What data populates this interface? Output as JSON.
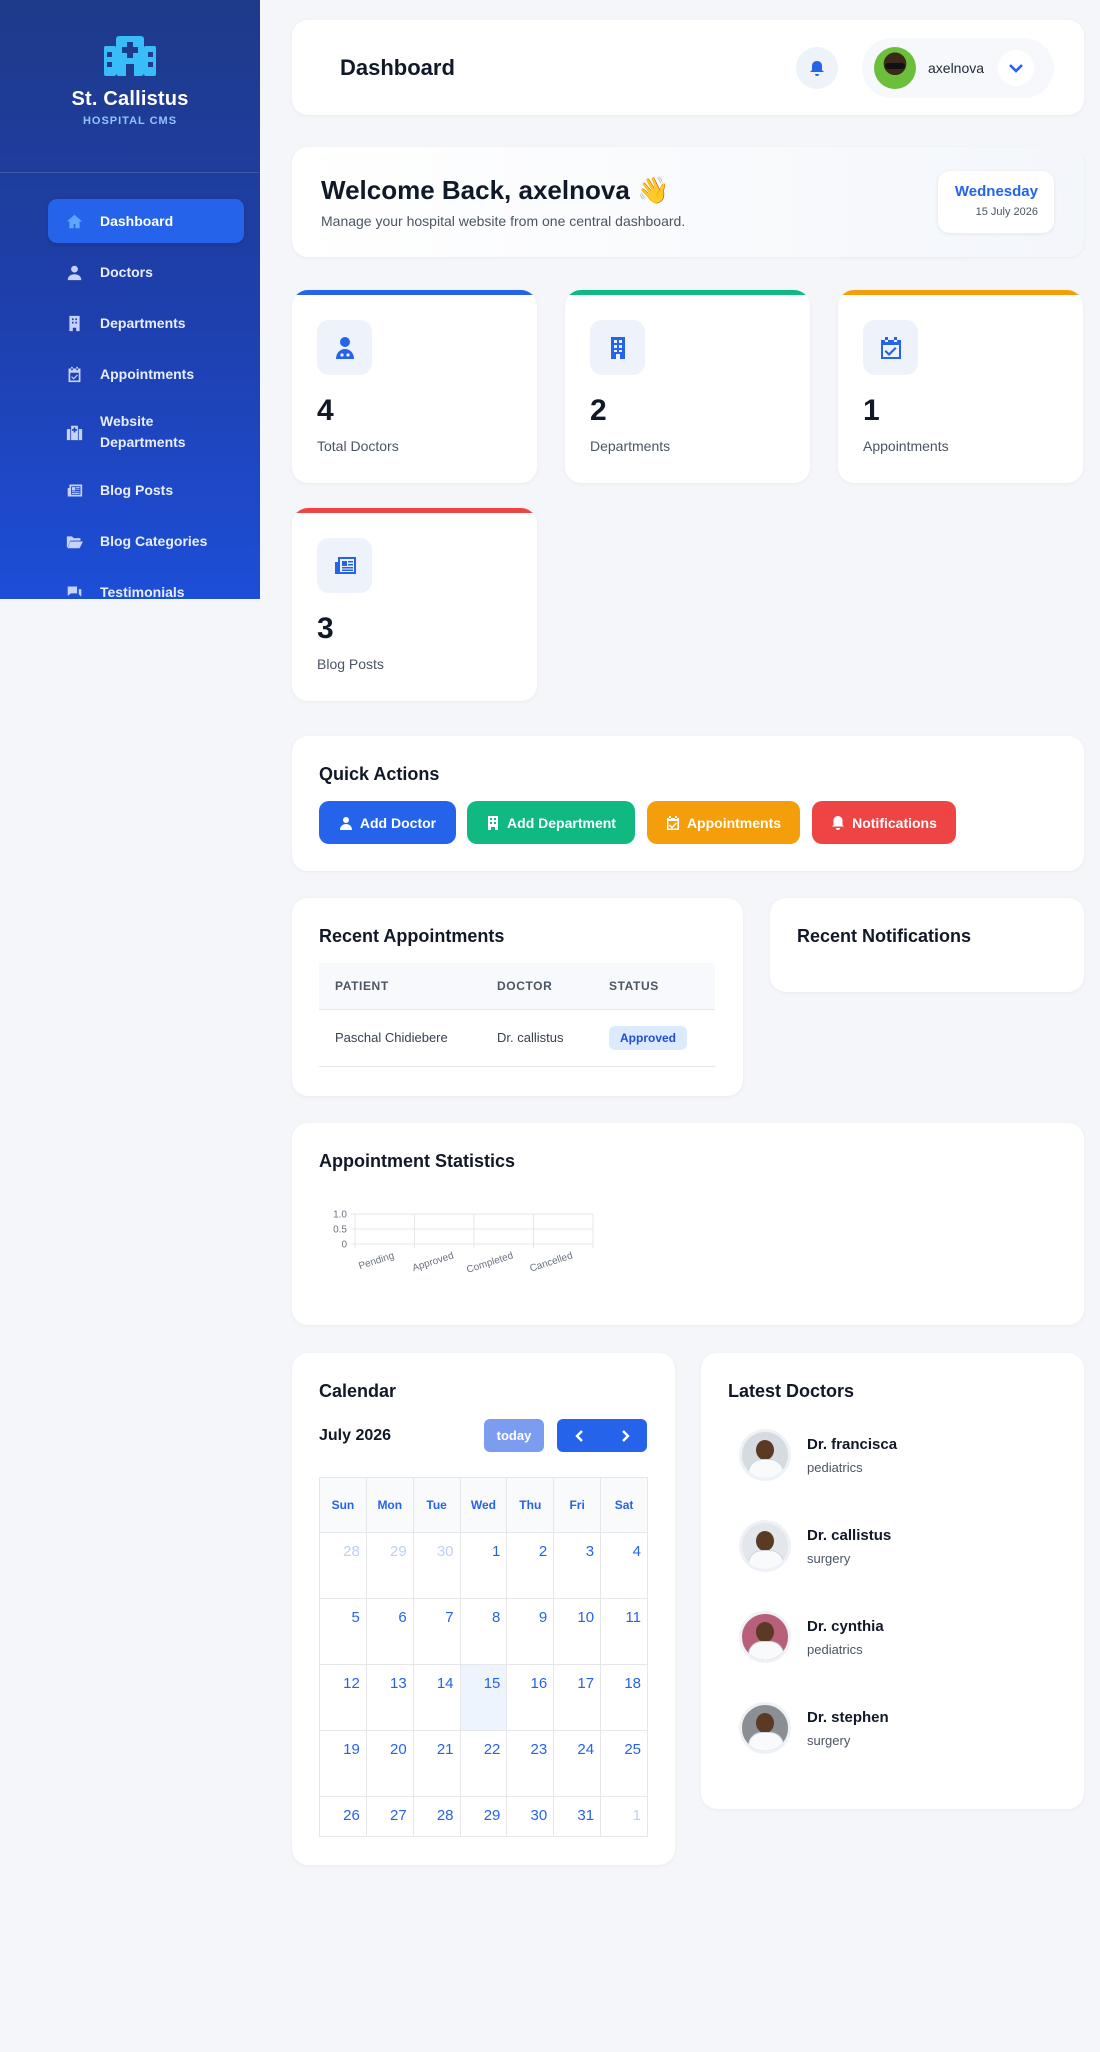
{
  "sidebar": {
    "brand_name": "St. Callistus",
    "brand_sub": "HOSPITAL CMS",
    "items": [
      {
        "label": "Dashboard",
        "icon": "home-icon"
      },
      {
        "label": "Doctors",
        "icon": "user-icon"
      },
      {
        "label": "Departments",
        "icon": "building-icon"
      },
      {
        "label": "Appointments",
        "icon": "calendar-check-icon"
      },
      {
        "label": "Website Departments",
        "icon": "hospital-icon"
      },
      {
        "label": "Blog Posts",
        "icon": "newspaper-icon"
      },
      {
        "label": "Blog Categories",
        "icon": "folder-open-icon"
      },
      {
        "label": "Testimonials",
        "icon": "comments-icon"
      }
    ]
  },
  "header": {
    "title": "Dashboard",
    "user_name": "axelnova"
  },
  "welcome": {
    "title": "Welcome Back, axelnova 👋",
    "subtitle": "Manage your hospital website from one central dashboard.",
    "day": "Wednesday",
    "date": "15 July 2026"
  },
  "stats": [
    {
      "value": "4",
      "label": "Total Doctors",
      "color": "#2563eb"
    },
    {
      "value": "2",
      "label": "Departments",
      "color": "#10b981"
    },
    {
      "value": "1",
      "label": "Appointments",
      "color": "#f59e0b"
    },
    {
      "value": "3",
      "label": "Blog Posts",
      "color": "#ef4444"
    }
  ],
  "quick_actions": {
    "title": "Quick Actions",
    "buttons": [
      {
        "label": "Add Doctor",
        "color": "#2563eb"
      },
      {
        "label": "Add Department",
        "color": "#10b981"
      },
      {
        "label": "Appointments",
        "color": "#f59e0b"
      },
      {
        "label": "Notifications",
        "color": "#ef4444"
      }
    ]
  },
  "recent_appointments": {
    "title": "Recent Appointments",
    "columns": [
      "PATIENT",
      "DOCTOR",
      "STATUS"
    ],
    "rows": [
      {
        "patient": "Paschal Chidiebere",
        "doctor": "Dr. callistus",
        "status": "Approved"
      }
    ]
  },
  "recent_notifications": {
    "title": "Recent Notifications"
  },
  "appointment_statistics": {
    "title": "Appointment Statistics"
  },
  "chart_data": {
    "type": "bar",
    "categories": [
      "Pending",
      "Approved",
      "Completed",
      "Cancelled"
    ],
    "values": [
      0,
      0,
      0,
      0
    ],
    "y_ticks": [
      "1.0",
      "0.5",
      "0"
    ],
    "ylim": [
      0,
      1
    ],
    "grid": true
  },
  "calendar": {
    "title": "Calendar",
    "month": "July 2026",
    "today_label": "today",
    "weekdays": [
      "Sun",
      "Mon",
      "Tue",
      "Wed",
      "Thu",
      "Fri",
      "Sat"
    ],
    "weeks": [
      [
        "28",
        "29",
        "30",
        "1",
        "2",
        "3",
        "4"
      ],
      [
        "5",
        "6",
        "7",
        "8",
        "9",
        "10",
        "11"
      ],
      [
        "12",
        "13",
        "14",
        "15",
        "16",
        "17",
        "18"
      ],
      [
        "19",
        "20",
        "21",
        "22",
        "23",
        "24",
        "25"
      ],
      [
        "26",
        "27",
        "28",
        "29",
        "30",
        "31",
        "1"
      ]
    ]
  },
  "latest_doctors": {
    "title": "Latest Doctors",
    "items": [
      {
        "name": "Dr. francisca",
        "specialty": "pediatrics"
      },
      {
        "name": "Dr. callistus",
        "specialty": "surgery"
      },
      {
        "name": "Dr. cynthia",
        "specialty": "pediatrics"
      },
      {
        "name": "Dr. stephen",
        "specialty": "surgery"
      }
    ]
  }
}
